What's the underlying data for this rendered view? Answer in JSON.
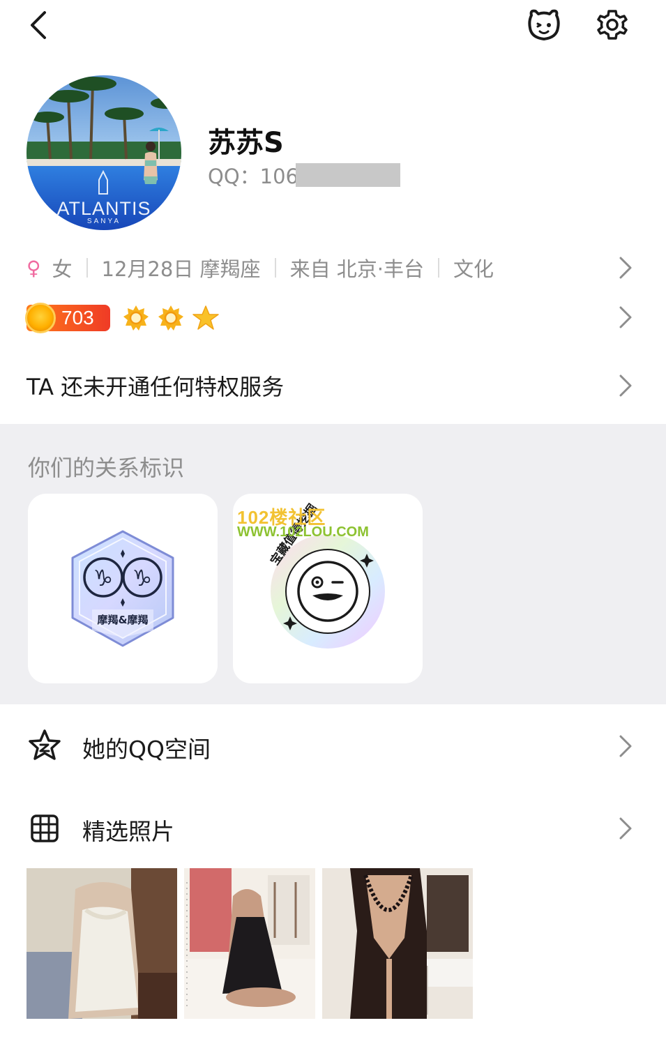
{
  "profile": {
    "nickname": "苏苏S",
    "qq_label": "QQ：106",
    "avatar_text_large": "ATLANTIS",
    "avatar_text_small": "SANYA"
  },
  "info": {
    "gender": "女",
    "birthday": "12月28日 摩羯座",
    "location": "来自 北京·丰台",
    "occupation": "文化"
  },
  "level": {
    "value": "703",
    "icons": [
      "sun-icon",
      "sun-icon",
      "star-icon"
    ]
  },
  "privilege": {
    "text": "TA 还未开通任何特权服务"
  },
  "relationship": {
    "title": "你们的关系标识",
    "badge1_label": "摩羯&摩羯",
    "badge2_ring_text": "宝藏值得挖掘",
    "watermark_line1": "102楼社区",
    "watermark_line2": "WWW.102LOU.COM"
  },
  "menu": {
    "qzone_label": "她的QQ空间",
    "photos_label": "精选照片"
  },
  "colors": {
    "accent_female": "#f06ba0",
    "level_badge": "#ef3b26",
    "section_bg": "#efeff2"
  }
}
